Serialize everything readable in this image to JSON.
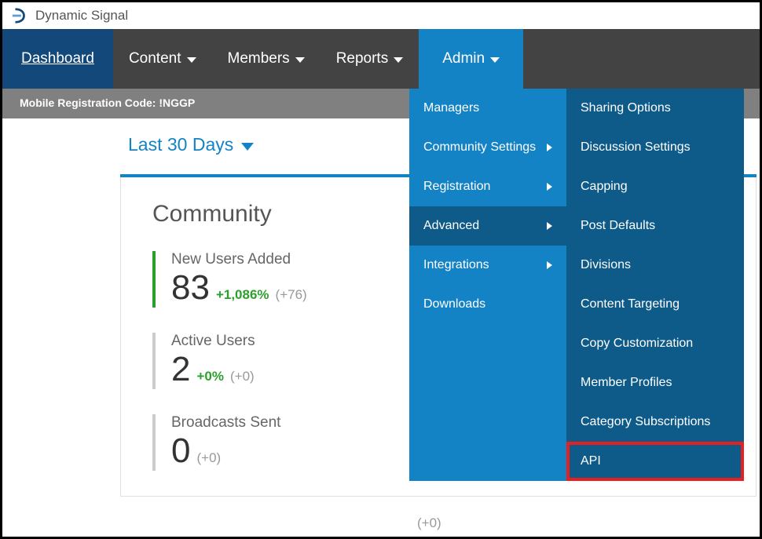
{
  "brand": {
    "name": "Dynamic Signal"
  },
  "nav": {
    "dashboard": "Dashboard",
    "content": "Content",
    "members": "Members",
    "reports": "Reports",
    "admin": "Admin"
  },
  "reg_code": {
    "label": "Mobile Registration Code: !NGGP"
  },
  "date_filter": {
    "label": "Last 30 Days"
  },
  "panel": {
    "title": "Community",
    "stats": {
      "new_users": {
        "label": "New Users Added",
        "value": "83",
        "pct": "+1,086%",
        "delta": "(+76)"
      },
      "active_users": {
        "label": "Active Users",
        "value": "2",
        "pct": "+0%",
        "delta": "(+0)"
      },
      "broadcasts": {
        "label": "Broadcasts Sent",
        "value": "0",
        "delta": "(+0)"
      }
    },
    "faded_delta": "(+0)"
  },
  "admin_menu": {
    "col1": {
      "managers": "Managers",
      "community_settings": "Community Settings",
      "registration": "Registration",
      "advanced": "Advanced",
      "integrations": "Integrations",
      "downloads": "Downloads"
    },
    "col2": {
      "sharing_options": "Sharing Options",
      "discussion_settings": "Discussion Settings",
      "capping": "Capping",
      "post_defaults": "Post Defaults",
      "divisions": "Divisions",
      "content_targeting": "Content Targeting",
      "copy_customization": "Copy Customization",
      "member_profiles": "Member Profiles",
      "category_subscriptions": "Category Subscriptions",
      "api": "API"
    }
  }
}
